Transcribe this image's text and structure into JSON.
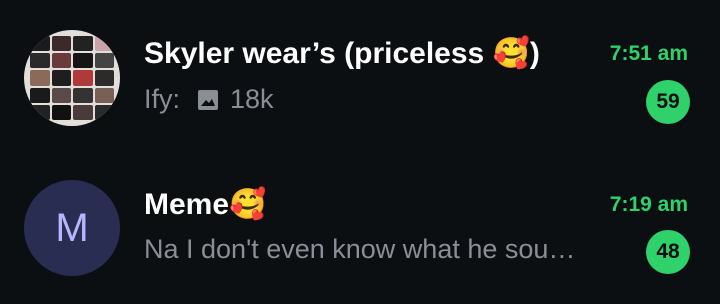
{
  "chats": [
    {
      "title": "Skyler wear’s (priceless 🥰)",
      "time": "7:51 am",
      "preview_sender": "Ify:",
      "preview_icon": "image-icon",
      "preview_text": "18k",
      "unread": "59"
    },
    {
      "title": "Meme🥰",
      "avatar_initial": "M",
      "time": "7:19 am",
      "preview_text": "Na I don't even know what he sou…",
      "unread": "48"
    }
  ],
  "colors": {
    "background": "#0b0f12",
    "accent": "#2ed16a",
    "title": "#ffffff",
    "preview": "#8a8f96",
    "avatar_m_bg": "#2a2d52",
    "avatar_m_fg": "#b9b6ff"
  }
}
